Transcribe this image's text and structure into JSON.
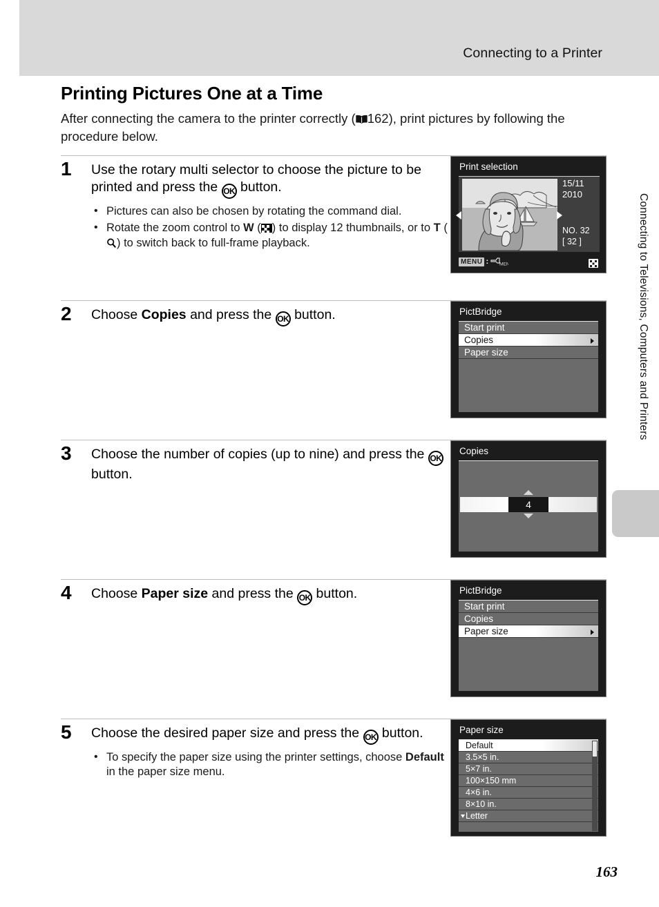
{
  "header": {
    "title": "Connecting to a Printer"
  },
  "side_tab": {
    "label": "Connecting to Televisions, Computers and Printers"
  },
  "page": {
    "heading": "Printing Pictures One at a Time",
    "intro_before_ref": "After connecting the camera to the printer correctly (",
    "intro_ref_icon": "book-icon",
    "intro_ref_page": "162",
    "intro_after_ref": "), print pictures by following the procedure below.",
    "number": "163"
  },
  "steps": [
    {
      "num": "1",
      "title_parts": {
        "a": "Use the rotary multi selector to choose the picture to be printed and press the ",
        "ok": "OK",
        "b": " button."
      },
      "bullets": [
        {
          "parts": [
            {
              "type": "text",
              "value": "Pictures can also be chosen by rotating the command dial."
            }
          ]
        },
        {
          "parts": [
            {
              "type": "text",
              "value": "Rotate the zoom control to "
            },
            {
              "type": "bold",
              "value": "W"
            },
            {
              "type": "text",
              "value": " ("
            },
            {
              "type": "icon",
              "value": "thumbnail-grid-icon"
            },
            {
              "type": "text",
              "value": ") to display 12 thumbnails, or to "
            },
            {
              "type": "bold",
              "value": "T"
            },
            {
              "type": "text",
              "value": " ("
            },
            {
              "type": "icon",
              "value": "magnifier-icon"
            },
            {
              "type": "text",
              "value": ") to switch back to full-frame playback."
            }
          ]
        }
      ]
    },
    {
      "num": "2",
      "title_parts": {
        "a": "Choose ",
        "bold": "Copies",
        "b": " and press the ",
        "ok": "OK",
        "c": " button."
      },
      "bullets": []
    },
    {
      "num": "3",
      "title_parts": {
        "a": "Choose the number of copies (up to nine) and press the ",
        "ok": "OK",
        "b": " button."
      },
      "bullets": []
    },
    {
      "num": "4",
      "title_parts": {
        "a": "Choose ",
        "bold": "Paper size",
        "b": " and press the ",
        "ok": "OK",
        "c": " button."
      },
      "bullets": []
    },
    {
      "num": "5",
      "title_parts": {
        "a": "Choose the desired paper size and press the ",
        "ok": "OK",
        "b": " button."
      },
      "bullets": [
        {
          "parts": [
            {
              "type": "text",
              "value": "To specify the paper size using the printer settings, choose "
            },
            {
              "type": "bold",
              "value": "Default"
            },
            {
              "type": "text",
              "value": " in the paper size menu."
            }
          ]
        }
      ]
    }
  ],
  "screens": {
    "print_selection": {
      "title": "Print selection",
      "date_line1": "15/11",
      "date_line2": "2010",
      "number_label": "NO.  32",
      "bracket_label": "[    32 ]",
      "menu_badge": "MENU",
      "menu_colon": ":",
      "printer_menu_label": "MENU",
      "thumbnail_icon": "thumbnail-grid-icon"
    },
    "pictbridge_copies": {
      "title": "PictBridge",
      "items": [
        {
          "label": "Start print",
          "selected": false,
          "arrow": false
        },
        {
          "label": "Copies",
          "selected": true,
          "arrow": true
        },
        {
          "label": "Paper size",
          "selected": false,
          "arrow": false
        }
      ]
    },
    "copies": {
      "title": "Copies",
      "value": "4"
    },
    "pictbridge_paper": {
      "title": "PictBridge",
      "items": [
        {
          "label": "Start print",
          "selected": false,
          "arrow": false
        },
        {
          "label": "Copies",
          "selected": false,
          "arrow": false
        },
        {
          "label": "Paper size",
          "selected": true,
          "arrow": true
        }
      ]
    },
    "paper_size": {
      "title": "Paper size",
      "items": [
        {
          "label": "Default",
          "selected": true,
          "more": false
        },
        {
          "label": "3.5×5 in.",
          "selected": false,
          "more": false
        },
        {
          "label": "5×7 in.",
          "selected": false,
          "more": false
        },
        {
          "label": "100×150 mm",
          "selected": false,
          "more": false
        },
        {
          "label": "4×6 in.",
          "selected": false,
          "more": false
        },
        {
          "label": "8×10 in.",
          "selected": false,
          "more": false
        },
        {
          "label": "Letter",
          "selected": false,
          "more": true
        }
      ]
    }
  }
}
